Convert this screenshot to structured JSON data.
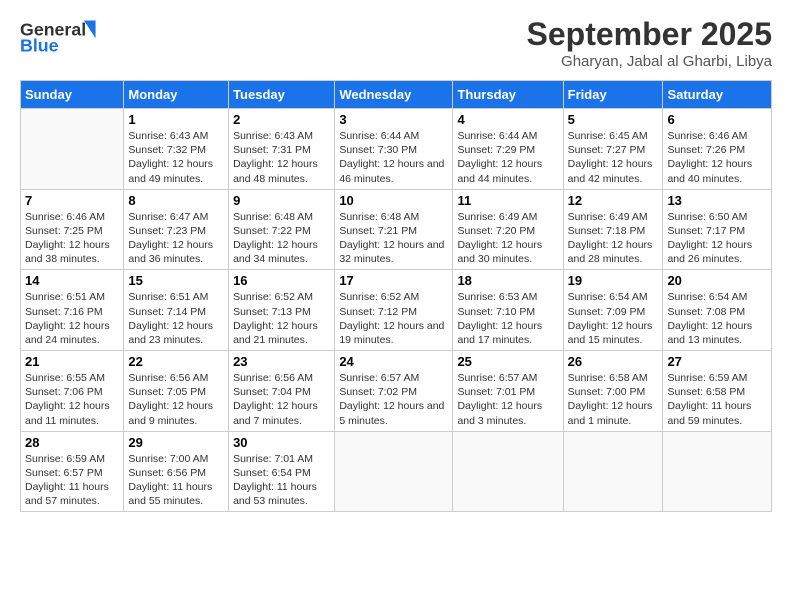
{
  "logo": {
    "line1": "General",
    "line2": "Blue"
  },
  "title": "September 2025",
  "subtitle": "Gharyan, Jabal al Gharbi, Libya",
  "days_of_week": [
    "Sunday",
    "Monday",
    "Tuesday",
    "Wednesday",
    "Thursday",
    "Friday",
    "Saturday"
  ],
  "weeks": [
    [
      {
        "day": "",
        "sunrise": "",
        "sunset": "",
        "daylight": ""
      },
      {
        "day": "1",
        "sunrise": "Sunrise: 6:43 AM",
        "sunset": "Sunset: 7:32 PM",
        "daylight": "Daylight: 12 hours and 49 minutes."
      },
      {
        "day": "2",
        "sunrise": "Sunrise: 6:43 AM",
        "sunset": "Sunset: 7:31 PM",
        "daylight": "Daylight: 12 hours and 48 minutes."
      },
      {
        "day": "3",
        "sunrise": "Sunrise: 6:44 AM",
        "sunset": "Sunset: 7:30 PM",
        "daylight": "Daylight: 12 hours and 46 minutes."
      },
      {
        "day": "4",
        "sunrise": "Sunrise: 6:44 AM",
        "sunset": "Sunset: 7:29 PM",
        "daylight": "Daylight: 12 hours and 44 minutes."
      },
      {
        "day": "5",
        "sunrise": "Sunrise: 6:45 AM",
        "sunset": "Sunset: 7:27 PM",
        "daylight": "Daylight: 12 hours and 42 minutes."
      },
      {
        "day": "6",
        "sunrise": "Sunrise: 6:46 AM",
        "sunset": "Sunset: 7:26 PM",
        "daylight": "Daylight: 12 hours and 40 minutes."
      }
    ],
    [
      {
        "day": "7",
        "sunrise": "Sunrise: 6:46 AM",
        "sunset": "Sunset: 7:25 PM",
        "daylight": "Daylight: 12 hours and 38 minutes."
      },
      {
        "day": "8",
        "sunrise": "Sunrise: 6:47 AM",
        "sunset": "Sunset: 7:23 PM",
        "daylight": "Daylight: 12 hours and 36 minutes."
      },
      {
        "day": "9",
        "sunrise": "Sunrise: 6:48 AM",
        "sunset": "Sunset: 7:22 PM",
        "daylight": "Daylight: 12 hours and 34 minutes."
      },
      {
        "day": "10",
        "sunrise": "Sunrise: 6:48 AM",
        "sunset": "Sunset: 7:21 PM",
        "daylight": "Daylight: 12 hours and 32 minutes."
      },
      {
        "day": "11",
        "sunrise": "Sunrise: 6:49 AM",
        "sunset": "Sunset: 7:20 PM",
        "daylight": "Daylight: 12 hours and 30 minutes."
      },
      {
        "day": "12",
        "sunrise": "Sunrise: 6:49 AM",
        "sunset": "Sunset: 7:18 PM",
        "daylight": "Daylight: 12 hours and 28 minutes."
      },
      {
        "day": "13",
        "sunrise": "Sunrise: 6:50 AM",
        "sunset": "Sunset: 7:17 PM",
        "daylight": "Daylight: 12 hours and 26 minutes."
      }
    ],
    [
      {
        "day": "14",
        "sunrise": "Sunrise: 6:51 AM",
        "sunset": "Sunset: 7:16 PM",
        "daylight": "Daylight: 12 hours and 24 minutes."
      },
      {
        "day": "15",
        "sunrise": "Sunrise: 6:51 AM",
        "sunset": "Sunset: 7:14 PM",
        "daylight": "Daylight: 12 hours and 23 minutes."
      },
      {
        "day": "16",
        "sunrise": "Sunrise: 6:52 AM",
        "sunset": "Sunset: 7:13 PM",
        "daylight": "Daylight: 12 hours and 21 minutes."
      },
      {
        "day": "17",
        "sunrise": "Sunrise: 6:52 AM",
        "sunset": "Sunset: 7:12 PM",
        "daylight": "Daylight: 12 hours and 19 minutes."
      },
      {
        "day": "18",
        "sunrise": "Sunrise: 6:53 AM",
        "sunset": "Sunset: 7:10 PM",
        "daylight": "Daylight: 12 hours and 17 minutes."
      },
      {
        "day": "19",
        "sunrise": "Sunrise: 6:54 AM",
        "sunset": "Sunset: 7:09 PM",
        "daylight": "Daylight: 12 hours and 15 minutes."
      },
      {
        "day": "20",
        "sunrise": "Sunrise: 6:54 AM",
        "sunset": "Sunset: 7:08 PM",
        "daylight": "Daylight: 12 hours and 13 minutes."
      }
    ],
    [
      {
        "day": "21",
        "sunrise": "Sunrise: 6:55 AM",
        "sunset": "Sunset: 7:06 PM",
        "daylight": "Daylight: 12 hours and 11 minutes."
      },
      {
        "day": "22",
        "sunrise": "Sunrise: 6:56 AM",
        "sunset": "Sunset: 7:05 PM",
        "daylight": "Daylight: 12 hours and 9 minutes."
      },
      {
        "day": "23",
        "sunrise": "Sunrise: 6:56 AM",
        "sunset": "Sunset: 7:04 PM",
        "daylight": "Daylight: 12 hours and 7 minutes."
      },
      {
        "day": "24",
        "sunrise": "Sunrise: 6:57 AM",
        "sunset": "Sunset: 7:02 PM",
        "daylight": "Daylight: 12 hours and 5 minutes."
      },
      {
        "day": "25",
        "sunrise": "Sunrise: 6:57 AM",
        "sunset": "Sunset: 7:01 PM",
        "daylight": "Daylight: 12 hours and 3 minutes."
      },
      {
        "day": "26",
        "sunrise": "Sunrise: 6:58 AM",
        "sunset": "Sunset: 7:00 PM",
        "daylight": "Daylight: 12 hours and 1 minute."
      },
      {
        "day": "27",
        "sunrise": "Sunrise: 6:59 AM",
        "sunset": "Sunset: 6:58 PM",
        "daylight": "Daylight: 11 hours and 59 minutes."
      }
    ],
    [
      {
        "day": "28",
        "sunrise": "Sunrise: 6:59 AM",
        "sunset": "Sunset: 6:57 PM",
        "daylight": "Daylight: 11 hours and 57 minutes."
      },
      {
        "day": "29",
        "sunrise": "Sunrise: 7:00 AM",
        "sunset": "Sunset: 6:56 PM",
        "daylight": "Daylight: 11 hours and 55 minutes."
      },
      {
        "day": "30",
        "sunrise": "Sunrise: 7:01 AM",
        "sunset": "Sunset: 6:54 PM",
        "daylight": "Daylight: 11 hours and 53 minutes."
      },
      {
        "day": "",
        "sunrise": "",
        "sunset": "",
        "daylight": ""
      },
      {
        "day": "",
        "sunrise": "",
        "sunset": "",
        "daylight": ""
      },
      {
        "day": "",
        "sunrise": "",
        "sunset": "",
        "daylight": ""
      },
      {
        "day": "",
        "sunrise": "",
        "sunset": "",
        "daylight": ""
      }
    ]
  ]
}
